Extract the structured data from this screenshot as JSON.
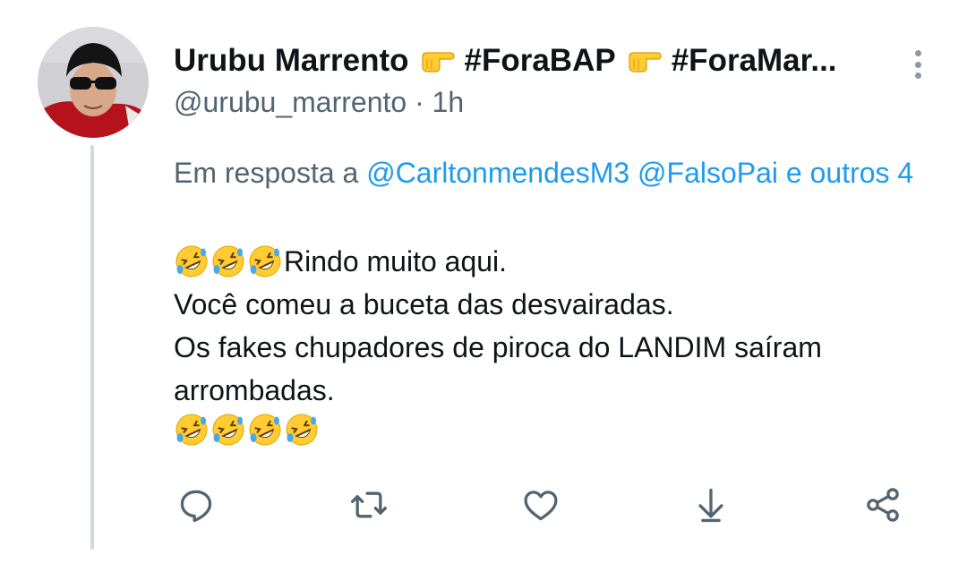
{
  "author": {
    "name": "Urubu Marrento",
    "tag1": "#ForaBAP",
    "tag2": "#ForaMar...",
    "handle": "@urubu_marrento",
    "separator": "·",
    "time": "1h"
  },
  "reply": {
    "prefix": "Em resposta a",
    "mention1": "@CarltonmendesM3",
    "mention2": "@FalsoPai",
    "conj": "e",
    "others": "outros 4"
  },
  "body": {
    "line1": "Rindo muito aqui.",
    "line2": "Você comeu a buceta das desvairadas.",
    "line3": "Os fakes chupadores de piroca do LANDIM saíram",
    "line4": "arrombadas."
  },
  "icons": {
    "pointing": "backhand-index-pointing-right-icon",
    "laugh": "rolling-on-floor-laughing-icon",
    "reply": "reply-icon",
    "retweet": "retweet-icon",
    "like": "heart-icon",
    "download": "download-icon",
    "share": "share-icon",
    "more": "more-vertical-icon"
  },
  "colors": {
    "link": "#1d9bf0",
    "secondary_text": "#536471",
    "action_icon": "#536471",
    "thread_line": "#cfd9de"
  }
}
